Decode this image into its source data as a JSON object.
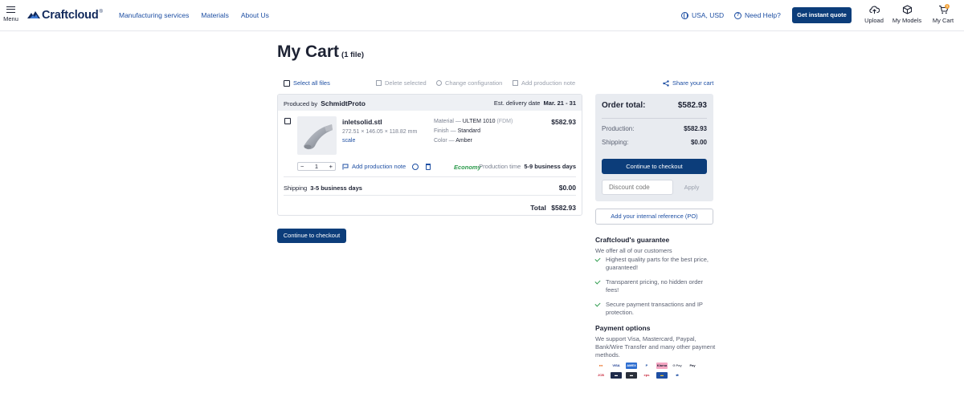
{
  "header": {
    "menu_label": "Menu",
    "logo_text": "Craftcloud",
    "logo_reg": "®",
    "nav": [
      "Manufacturing services",
      "Materials",
      "About Us"
    ],
    "region": "USA, USD",
    "help": "Need Help?",
    "quote_button": "Get instant quote",
    "upload": "Upload",
    "models": "My Models",
    "cart": "My Cart",
    "cart_count": "1"
  },
  "page": {
    "title": "My Cart",
    "file_count": "(1 file)"
  },
  "toolbar": {
    "select_all": "Select all files",
    "delete_selected": "Delete selected",
    "change_configuration": "Change configuration",
    "add_production_note": "Add production note",
    "share_cart": "Share your cart"
  },
  "cart": {
    "produced_by_label": "Produced by",
    "producer": "SchmidtProto",
    "delivery_label": "Est. delivery date",
    "delivery_date": "Mar. 21 - 31",
    "item": {
      "name": "inletsolid.stl",
      "dimensions": "272.51 × 146.05 × 118.82 mm",
      "scale_link": "scale",
      "material_label": "Material —",
      "material": "ULTEM 1010",
      "process": "(FDM)",
      "finish_label": "Finish —",
      "finish": "Standard",
      "color_label": "Color —",
      "color": "Amber",
      "price": "$582.93",
      "quantity": "1",
      "qty_minus": "−",
      "qty_plus": "+",
      "add_note": "Add production note",
      "tier": "Economy",
      "production_time_label": "Production time",
      "production_time": "5-9 business days"
    },
    "shipping_label": "Shipping",
    "shipping_time": "3-5 business days",
    "shipping_price": "$0.00",
    "total_label": "Total",
    "total": "$582.93",
    "checkout_button": "Continue to checkout"
  },
  "summary": {
    "title": "Order total:",
    "total": "$582.93",
    "production_label": "Production:",
    "production": "$582.93",
    "shipping_label": "Shipping:",
    "shipping": "$0.00",
    "checkout_button": "Continue to checkout",
    "discount_placeholder": "Discount code",
    "apply": "Apply",
    "po_button": "Add your internal reference (PO)"
  },
  "guarantee": {
    "title": "Craftcloud's guarantee",
    "subtitle": "We offer all of our customers",
    "items": [
      "Highest quality parts for the best price, guaranteed!",
      "Transparent pricing, no hidden order fees!",
      "Secure payment transactions and IP protection."
    ]
  },
  "payment": {
    "title": "Payment options",
    "text": "We support Visa, Mastercard, Paypal, Bank/Wire Transfer and many other payment methods.",
    "logos": [
      {
        "icon": "mastercard-icon",
        "text": "●●",
        "bg": "#ffffff",
        "fg": "#eb6b1e"
      },
      {
        "icon": "visa-icon",
        "text": "VISA",
        "bg": "#ffffff",
        "fg": "#1a3a8f"
      },
      {
        "icon": "amex-icon",
        "text": "AMEX",
        "bg": "#2f6fd1",
        "fg": "#ffffff"
      },
      {
        "icon": "paypal-icon",
        "text": "P",
        "bg": "#ffffff",
        "fg": "#1e4fa3"
      },
      {
        "icon": "klarna-icon",
        "text": "Klarna",
        "bg": "#f5a6c3",
        "fg": "#1d2233"
      },
      {
        "icon": "google-pay-icon",
        "text": "G Pay",
        "bg": "#ffffff",
        "fg": "#5b6172"
      },
      {
        "icon": "apple-pay-icon",
        "text": "Pay",
        "bg": "#ffffff",
        "fg": "#1d2233"
      },
      {
        "icon": "jcb-icon",
        "text": "JCB",
        "bg": "#ffffff",
        "fg": "#c8283c"
      },
      {
        "icon": "bank-card-icon",
        "text": "▬",
        "bg": "#1d2a4a",
        "fg": "#ffffff"
      },
      {
        "icon": "bank-transfer-icon",
        "text": "▬",
        "bg": "#2a2f3a",
        "fg": "#ffffff"
      },
      {
        "icon": "eps-icon",
        "text": "eps",
        "bg": "#ffffff",
        "fg": "#c8283c"
      },
      {
        "icon": "bancontact-icon",
        "text": "▬",
        "bg": "#1e4fa3",
        "fg": "#f2c230"
      },
      {
        "icon": "wire-icon",
        "text": "⇄",
        "bg": "#ffffff",
        "fg": "#1e4fa3"
      }
    ]
  }
}
